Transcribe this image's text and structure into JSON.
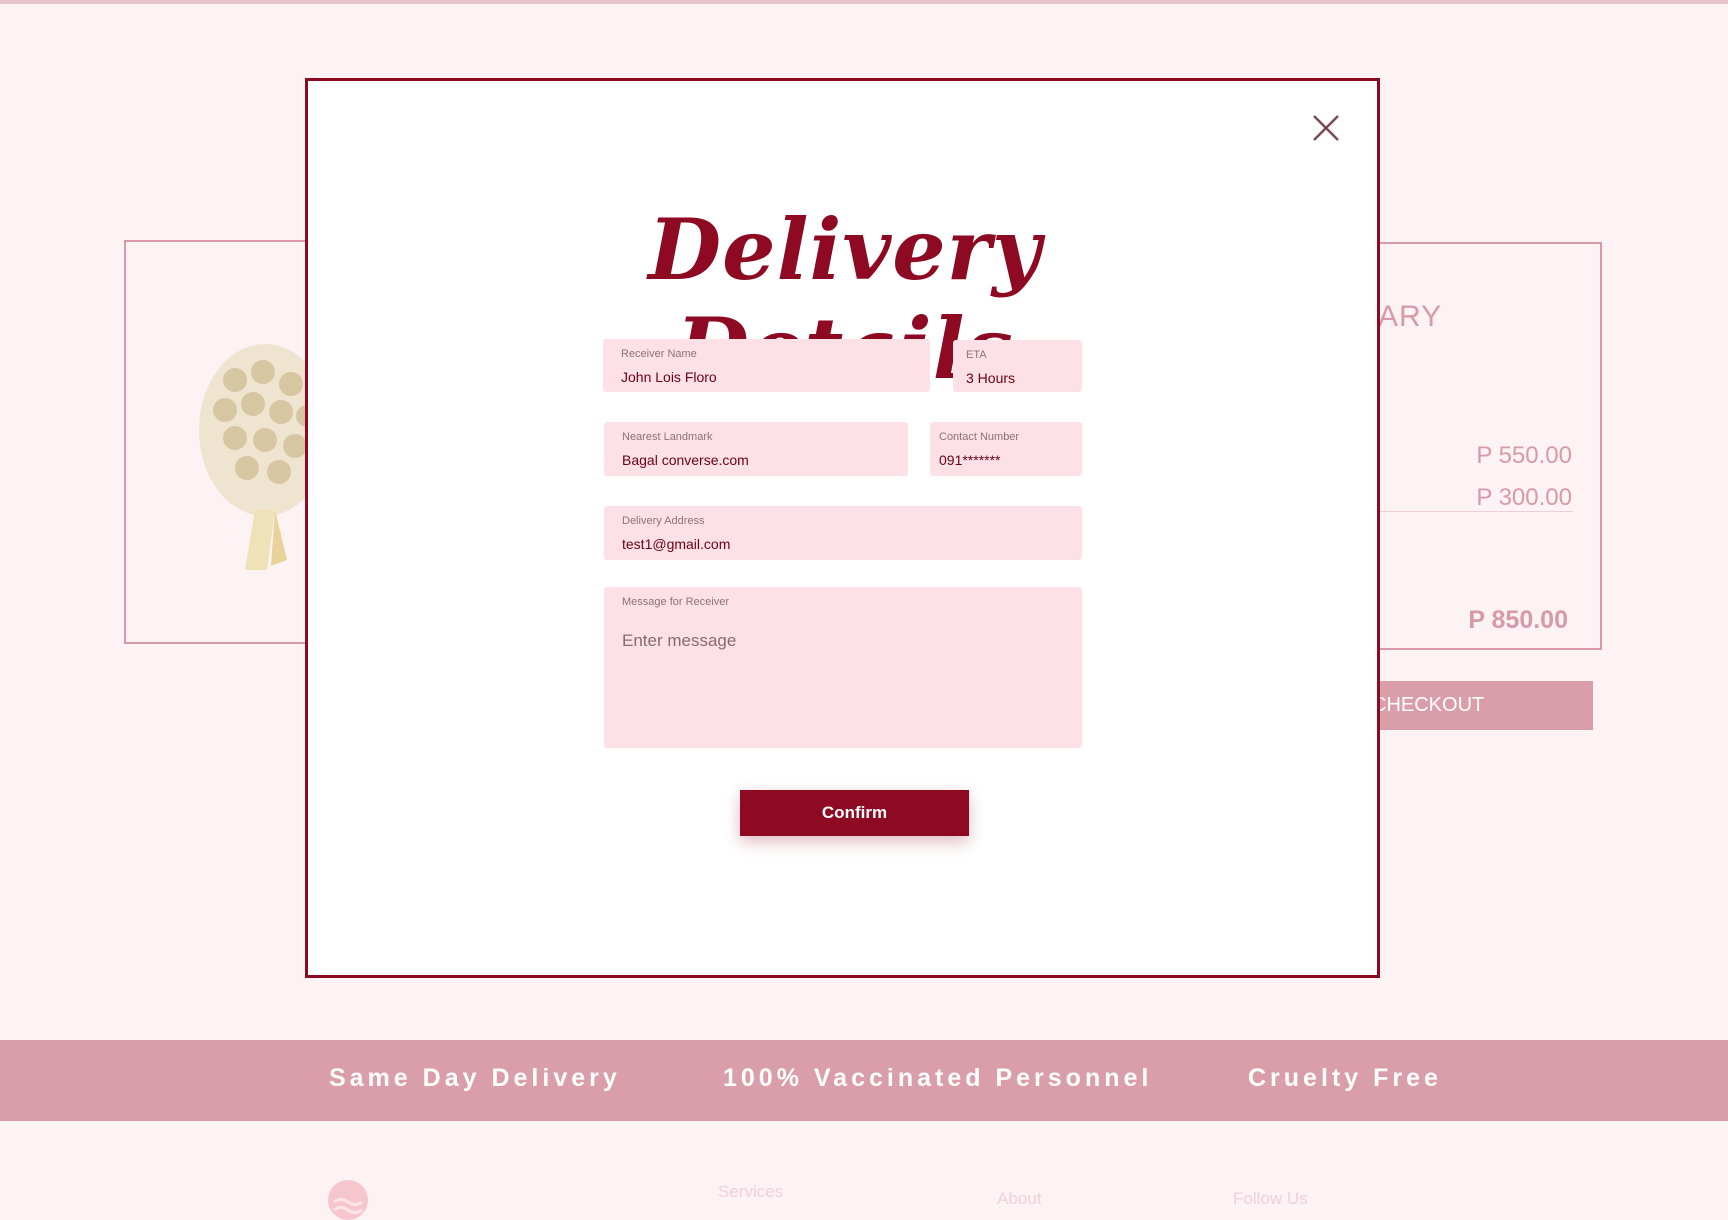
{
  "background": {
    "summary_title_partial": "ARY",
    "prices": [
      "P 550.00",
      "P 300.00"
    ],
    "total": "P 850.00",
    "checkout_label_partial": "CHECKOUT",
    "promos": [
      "Same Day Delivery",
      "100% Vaccinated Personnel",
      "Cruelty Free"
    ],
    "footer_links": [
      "Services",
      "About",
      "Follow Us"
    ]
  },
  "modal": {
    "title": "Delivery Details",
    "close_icon": "close-icon",
    "fields": {
      "receiver_name": {
        "label": "Receiver Name",
        "value": "John Lois Floro"
      },
      "eta": {
        "label": "ETA",
        "value": "3 Hours"
      },
      "nearest_landmark": {
        "label": "Nearest Landmark",
        "value": "Bagal converse.com"
      },
      "contact_number": {
        "label": "Contact Number",
        "value": "091*******"
      },
      "delivery_address": {
        "label": "Delivery Address",
        "value": "test1@gmail.com"
      },
      "message": {
        "label": "Message for Receiver",
        "placeholder": "Enter message"
      }
    },
    "confirm_label": "Confirm"
  },
  "colors": {
    "accent": "#8e0a22",
    "field_bg": "#fde1e6",
    "page_bg": "#fdf2f4",
    "band": "#d99eaa"
  }
}
